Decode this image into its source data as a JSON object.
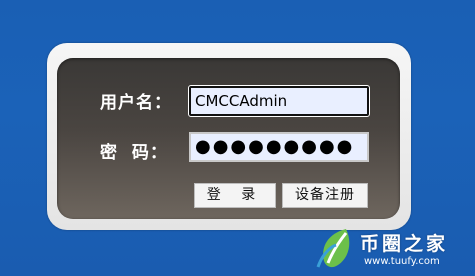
{
  "login": {
    "username_label": "用户名：",
    "password_label": "密  码：",
    "username_value": "CMCCAdmin",
    "password_value": "●●●●●●●●●",
    "login_button": "登 录",
    "register_button": "设备注册"
  },
  "watermark": {
    "brand": "币圈之家",
    "url": "www.tuufy.com"
  }
}
